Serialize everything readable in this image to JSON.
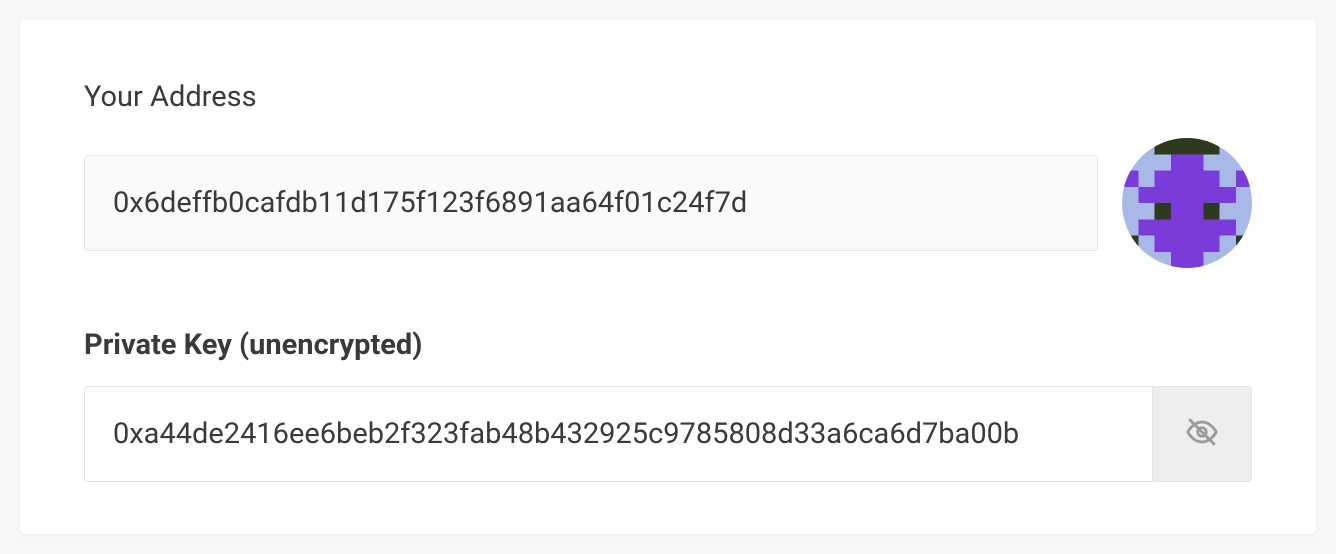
{
  "address": {
    "label": "Your Address",
    "value": "0x6deffb0cafdb11d175f123f6891aa64f01c24f7d"
  },
  "private_key": {
    "label": "Private Key (unencrypted)",
    "value": "0xa44de2416ee6beb2f323fab48b432925c9785808d33a6ca6d7ba00b"
  },
  "avatar": {
    "colors": {
      "bg": "#a8b9e8",
      "main": "#7a3bd8",
      "dark": "#2d3a1f"
    }
  }
}
